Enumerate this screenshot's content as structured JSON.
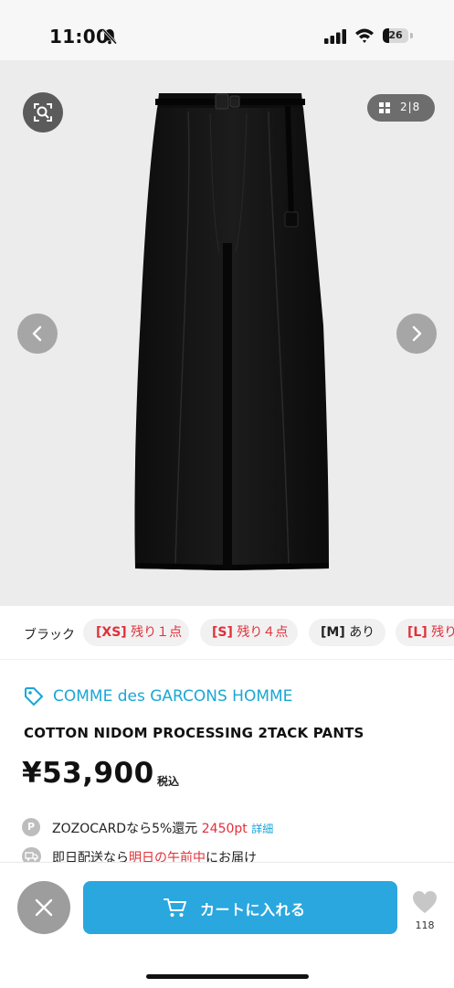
{
  "status_bar": {
    "time": "11:00",
    "battery": "26",
    "battery_level": 0.26
  },
  "gallery": {
    "counter": "2|8",
    "current": 2,
    "total": 8
  },
  "variant": {
    "color_label": "ブラック",
    "sizes": [
      {
        "size": "[XS]",
        "stock": "残り１点",
        "state": "low"
      },
      {
        "size": "[S]",
        "stock": "残り４点",
        "state": "low"
      },
      {
        "size": "[M]",
        "stock": "あり",
        "state": "ok"
      },
      {
        "size": "[L]",
        "stock": "残り",
        "state": "low"
      }
    ]
  },
  "product": {
    "brand": "COMME des GARCONS HOMME",
    "title": "COTTON NIDOM PROCESSING 2TACK PANTS",
    "price": "¥53,900",
    "tax_label": "税込"
  },
  "zozocard": {
    "badge": "P",
    "text": "ZOZOCARDなら5%還元",
    "points": "2450pt",
    "detail_link": "詳細"
  },
  "delivery": {
    "prefix": "即日配送なら",
    "highlight": "明日の午前中",
    "suffix": "にお届け"
  },
  "bottom_bar": {
    "cart_label": "カートに入れる",
    "favorite_count": "118"
  },
  "colors": {
    "accent": "#2aa7de",
    "brand_link": "#1aa6d6",
    "alert": "#e0303a"
  },
  "icons": [
    "bell-slash-icon",
    "signal-icon",
    "wifi-icon",
    "battery-icon",
    "image-search-icon",
    "grid-icon",
    "chevron-left-icon",
    "chevron-right-icon",
    "tag-icon",
    "point-icon",
    "truck-icon",
    "close-icon",
    "cart-icon",
    "heart-icon"
  ]
}
